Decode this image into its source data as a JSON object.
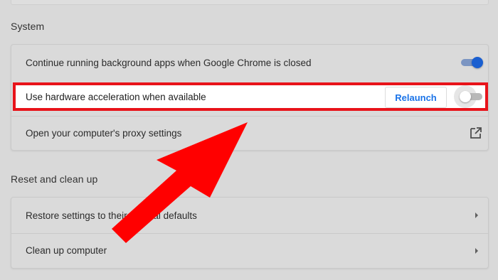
{
  "system_section": {
    "title": "System",
    "rows": [
      {
        "label": "Continue running background apps when Google Chrome is closed",
        "toggle": "on"
      },
      {
        "label": "Use hardware acceleration when available",
        "toggle": "off",
        "button": "Relaunch"
      },
      {
        "label": "Open your computer's proxy settings",
        "icon": "open-in-new-icon"
      }
    ]
  },
  "reset_section": {
    "title": "Reset and clean up",
    "rows": [
      {
        "label": "Restore settings to their original defaults",
        "icon": "chevron-right-icon"
      },
      {
        "label": "Clean up computer",
        "icon": "chevron-right-icon"
      }
    ]
  },
  "colors": {
    "highlight_border": "#e8131a",
    "arrow": "#ff0000",
    "toggle_on": "#1a5fd0",
    "relaunch_text": "#1a73e8"
  }
}
